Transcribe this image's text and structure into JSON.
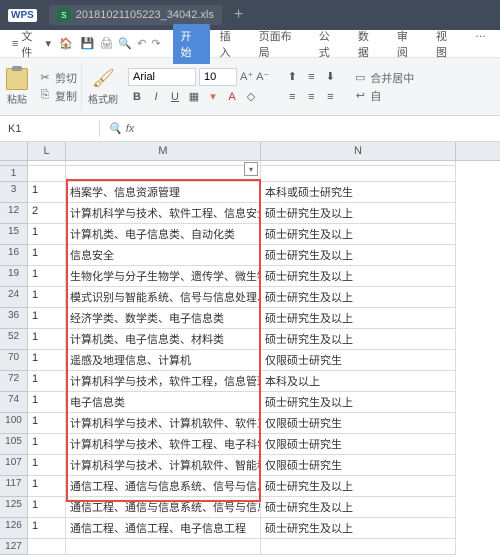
{
  "titlebar": {
    "wps": "WPS",
    "filename": "20181021105223_34042.xls"
  },
  "menubar": {
    "file": "文件",
    "tabs": [
      "开始",
      "插入",
      "页面布局",
      "公式",
      "数据",
      "审阅",
      "视图",
      "…"
    ],
    "active_index": 0
  },
  "ribbon": {
    "paste": "粘贴",
    "cut": "剪切",
    "copy": "复制",
    "format_painter": "格式刷",
    "font": "Arial",
    "size": "10",
    "merge": "合并居中",
    "wrap": "自"
  },
  "cellref": {
    "name": "K1",
    "fx": "fx"
  },
  "columns": [
    "",
    "L",
    "M",
    "N"
  ],
  "rows": [
    {
      "h": "",
      "l": "",
      "m": "",
      "n": ""
    },
    {
      "h": "1",
      "l": "",
      "m": "",
      "n": ""
    },
    {
      "h": "3",
      "l": "1",
      "m": "档案学、信息资源管理",
      "n": "本科或硕士研究生"
    },
    {
      "h": "12",
      "l": "2",
      "m": "计算机科学与技术、软件工程、信息安全、计算机",
      "n": "硕士研究生及以上"
    },
    {
      "h": "15",
      "l": "1",
      "m": "计算机类、电子信息类、自动化类",
      "n": "硕士研究生及以上"
    },
    {
      "h": "16",
      "l": "1",
      "m": "信息安全",
      "n": "硕士研究生及以上"
    },
    {
      "h": "19",
      "l": "1",
      "m": "生物化学与分子生物学、遗传学、微生物学、法医学",
      "n": "硕士研究生及以上"
    },
    {
      "h": "24",
      "l": "1",
      "m": "模式识别与智能系统、信号与信息处理、光学工程",
      "n": "硕士研究生及以上"
    },
    {
      "h": "36",
      "l": "1",
      "m": "经济学类、数学类、电子信息类",
      "n": "硕士研究生及以上"
    },
    {
      "h": "52",
      "l": "1",
      "m": "计算机类、电子信息类、材料类",
      "n": "硕士研究生及以上"
    },
    {
      "h": "70",
      "l": "1",
      "m": "遥感及地理信息、计算机",
      "n": "仅限硕士研究生"
    },
    {
      "h": "72",
      "l": "1",
      "m": "计算机科学与技术，软件工程，信息管理与系统",
      "n": "本科及以上"
    },
    {
      "h": "74",
      "l": "1",
      "m": "电子信息类",
      "n": "硕士研究生及以上"
    },
    {
      "h": "100",
      "l": "1",
      "m": "计算机科学与技术、计算机软件、软件工程、计算机",
      "n": "仅限硕士研究生"
    },
    {
      "h": "105",
      "l": "1",
      "m": "计算机科学与技术、软件工程、电子科学与技术、信",
      "n": "仅限硕士研究生"
    },
    {
      "h": "107",
      "l": "1",
      "m": "计算机科学与技术、计算机软件、智能科学与技术、",
      "n": "仅限硕士研究生"
    },
    {
      "h": "117",
      "l": "1",
      "m": "通信工程、通信与信息系统、信号与信息处理、电磁",
      "n": "硕士研究生及以上"
    },
    {
      "h": "125",
      "l": "1",
      "m": "通信工程、通信与信息系统、信号与信息处理、电磁",
      "n": "硕士研究生及以上"
    },
    {
      "h": "126",
      "l": "1",
      "m": "通信工程、通信工程、电子信息工程",
      "n": "硕士研究生及以上"
    },
    {
      "h": "127",
      "l": "",
      "m": "",
      "n": ""
    }
  ]
}
